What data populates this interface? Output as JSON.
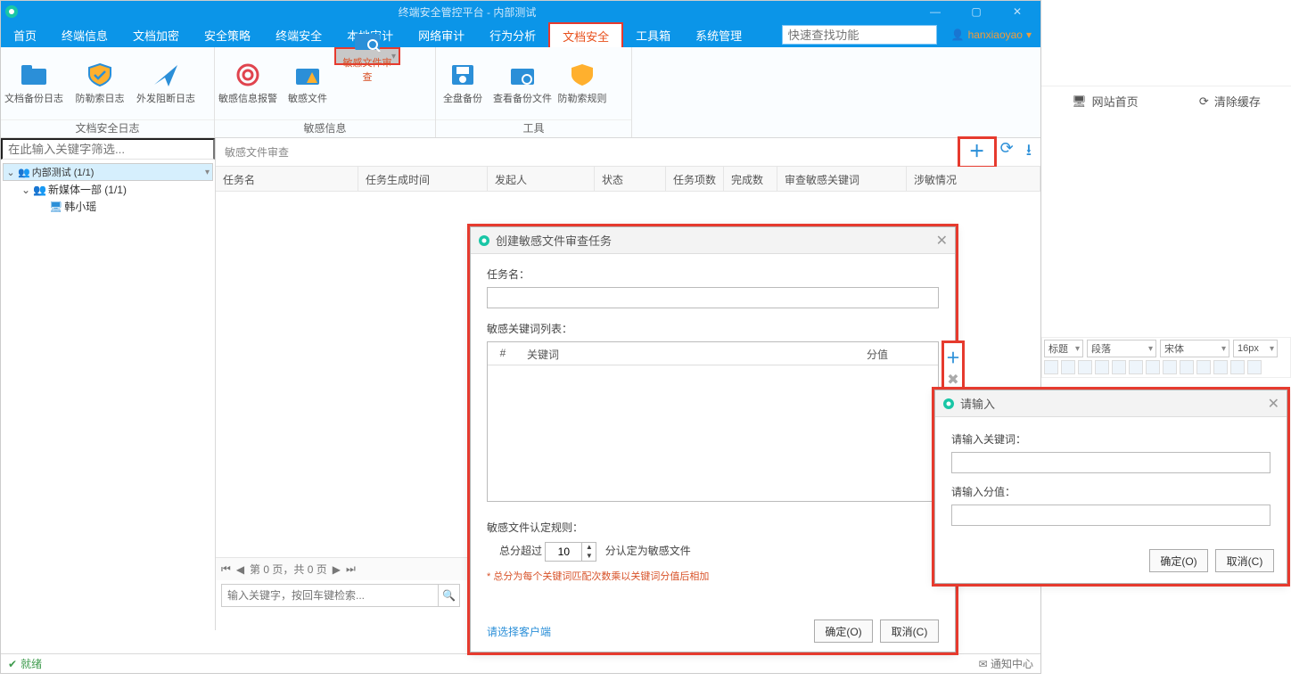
{
  "window": {
    "title": "终端安全管控平台 - 内部测试"
  },
  "menu": {
    "items": [
      "首页",
      "终端信息",
      "文档加密",
      "安全策略",
      "终端安全",
      "本地审计",
      "网络审计",
      "行为分析",
      "文档安全",
      "工具箱",
      "系统管理"
    ],
    "active_index": 8,
    "search_placeholder": "快速查找功能",
    "user": "hanxiaoyao"
  },
  "ribbon": {
    "groups": [
      {
        "caption": "文档安全日志",
        "items": [
          {
            "label": "文档备份日志",
            "icon": "folder"
          },
          {
            "label": "防勒索日志",
            "icon": "shield"
          },
          {
            "label": "外发阻断日志",
            "icon": "send"
          }
        ]
      },
      {
        "caption": "敏感信息",
        "items": [
          {
            "label": "敏感信息报警",
            "icon": "target"
          },
          {
            "label": "敏感文件",
            "icon": "folder-warn"
          },
          {
            "label": "敏感文件审查",
            "icon": "folder-search",
            "selected": true
          }
        ]
      },
      {
        "caption": "工具",
        "items": [
          {
            "label": "全盘备份",
            "icon": "save"
          },
          {
            "label": "查看备份文件",
            "icon": "folder-view"
          },
          {
            "label": "防勒索规则",
            "icon": "rule"
          }
        ]
      }
    ]
  },
  "tree": {
    "filter_placeholder": "在此输入关键字筛选...",
    "nodes": [
      {
        "label": "内部测试 (1/1)",
        "level": 0,
        "open": true,
        "sel": true,
        "icon": "people"
      },
      {
        "label": "新媒体一部 (1/1)",
        "level": 1,
        "open": true,
        "icon": "people"
      },
      {
        "label": "韩小瑶",
        "level": 2,
        "icon": "pc"
      }
    ]
  },
  "grid": {
    "breadcrumb": "敏感文件审查",
    "columns": [
      "任务名",
      "任务生成时间",
      "发起人",
      "状态",
      "任务项数",
      "完成数",
      "审查敏感关键词",
      "涉敏情况"
    ]
  },
  "pager": {
    "text": "第 0 页，共 0 页"
  },
  "footer_search_placeholder": "输入关键字，按回车键检索...",
  "status": {
    "left": "就绪",
    "right": "通知中心"
  },
  "dialog1": {
    "title": "创建敏感文件审查任务",
    "l_taskname": "任务名：",
    "l_kwlist": "敏感关键词列表：",
    "kw_cols": {
      "idx": "#",
      "word": "关键词",
      "score": "分值"
    },
    "l_rule": "敏感文件认定规则：",
    "l_total": "总分超过",
    "score_value": "10",
    "l_judge": "分认定为敏感文件",
    "note": "* 总分为每个关键词匹配次数乘以关键词分值后相加",
    "link": "请选择客户端",
    "ok": "确定(O)",
    "cancel": "取消(C)"
  },
  "dialog2": {
    "title": "请输入",
    "l_kw": "请输入关键词：",
    "l_sc": "请输入分值：",
    "ok": "确定(O)",
    "cancel": "取消(C)"
  },
  "rightpane": {
    "home": "网站首页",
    "clear": "清除缓存",
    "editor": {
      "sel1": "标题",
      "sel2": "段落",
      "sel3": "宋体",
      "sel4": "16px"
    }
  }
}
